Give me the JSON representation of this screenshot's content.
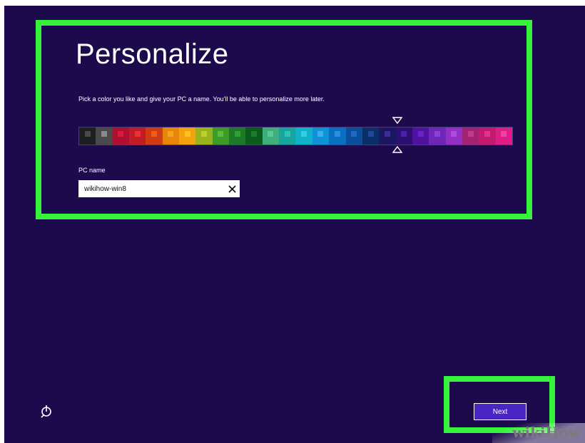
{
  "page": {
    "title": "Personalize",
    "subtitle": "Pick a color you like and give your PC a name. You'll be able to personalize more later."
  },
  "palette": {
    "selected_index": 21,
    "swatches": [
      {
        "bg": "#1f1f1f",
        "accent": "#4a4a4a"
      },
      {
        "bg": "#4a4a4a",
        "accent": "#8a8a8a"
      },
      {
        "bg": "#b01030",
        "accent": "#d81b3c"
      },
      {
        "bg": "#c31c26",
        "accent": "#e6333b"
      },
      {
        "bg": "#cf3b12",
        "accent": "#ef5a1e"
      },
      {
        "bg": "#e8860b",
        "accent": "#f5a318"
      },
      {
        "bg": "#f2a20a",
        "accent": "#ffbf23"
      },
      {
        "bg": "#9ab21b",
        "accent": "#b8d02a"
      },
      {
        "bg": "#3e9b28",
        "accent": "#5abd35"
      },
      {
        "bg": "#1c7a26",
        "accent": "#2e9e35"
      },
      {
        "bg": "#0c5c1e",
        "accent": "#1e7d2d"
      },
      {
        "bg": "#3fae7c",
        "accent": "#5cc896"
      },
      {
        "bg": "#18a69a",
        "accent": "#2fc3b4"
      },
      {
        "bg": "#0fb2c7",
        "accent": "#37cde0"
      },
      {
        "bg": "#0e94d4",
        "accent": "#34b2ee"
      },
      {
        "bg": "#0a6fc2",
        "accent": "#2d8ee0"
      },
      {
        "bg": "#0a4f9c",
        "accent": "#1f6cc0"
      },
      {
        "bg": "#0b2f6b",
        "accent": "#1c4a95"
      },
      {
        "bg": "#1c1660",
        "accent": "#3a2f95"
      },
      {
        "bg": "#2c0f6e",
        "accent": "#4a21a6"
      },
      {
        "bg": "#5012a0",
        "accent": "#6a23c4"
      },
      {
        "bg": "#6e25b8",
        "accent": "#8c3fd8"
      },
      {
        "bg": "#932fc5",
        "accent": "#b04ae0"
      },
      {
        "bg": "#a2236f",
        "accent": "#c23a8e"
      },
      {
        "bg": "#c21a6e",
        "accent": "#e1338c"
      },
      {
        "bg": "#de1d86",
        "accent": "#f542a3"
      }
    ]
  },
  "pc_name": {
    "label": "PC name",
    "value": "wikihow-win8"
  },
  "buttons": {
    "next_label": "Next"
  },
  "watermark": {
    "text": "wikiHow"
  },
  "colors": {
    "background": "#1c0a4c",
    "highlight": "#35f23a",
    "button": "#4b25c3"
  }
}
